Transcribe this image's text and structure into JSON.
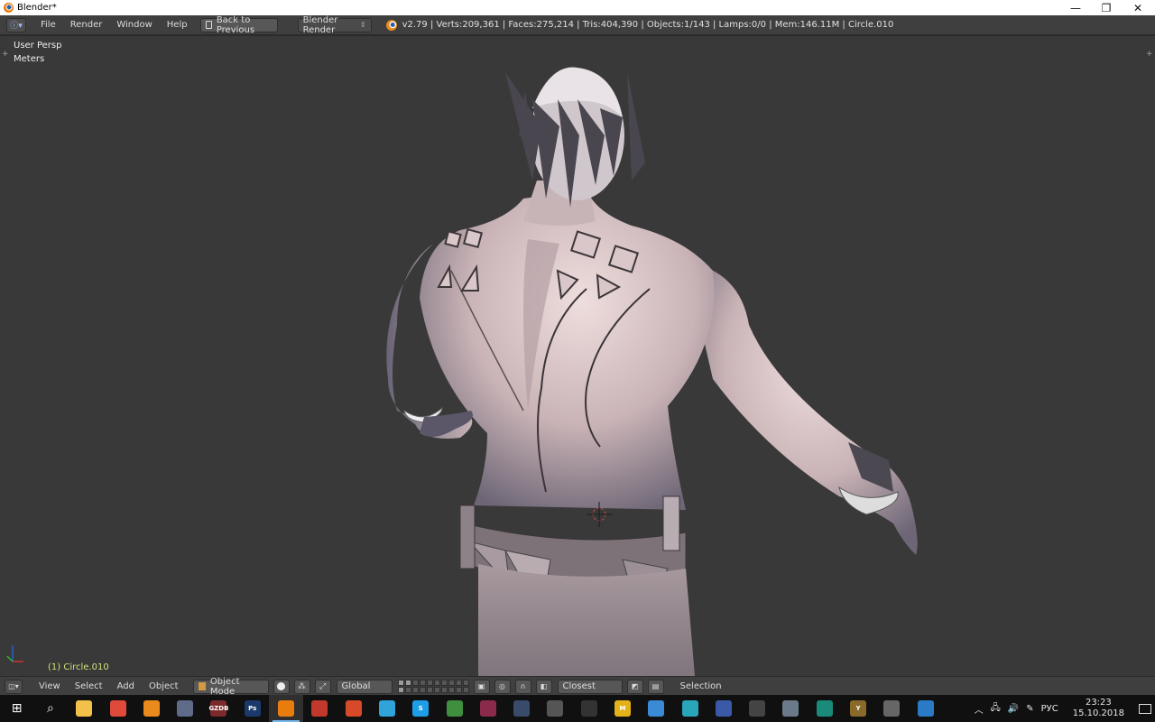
{
  "window": {
    "title": "Blender*",
    "controls": [
      "—",
      "❐",
      "✕"
    ]
  },
  "infobar": {
    "editor_icon": "info-icon",
    "menus": [
      "File",
      "Render",
      "Window",
      "Help"
    ],
    "back_button": "Back to Previous",
    "render_engine": "Blender Render",
    "stats": "v2.79 | Verts:209,361 | Faces:275,214 | Tris:404,390 | Objects:1/143 | Lamps:0/0 | Mem:146.11M | Circle.010"
  },
  "viewport": {
    "view_name": "User Persp",
    "units": "Meters",
    "active_object": "(1) Circle.010",
    "colors": {
      "background": "#393939",
      "object_label": "#cfe27a",
      "skin": "#d8c2c2"
    }
  },
  "header3d": {
    "menus": [
      "View",
      "Select",
      "Add",
      "Object"
    ],
    "mode": "Object Mode",
    "orientation": "Global",
    "snap_element": "Closest",
    "selection_label": "Selection"
  },
  "taskbar": {
    "apps": [
      {
        "name": "windows-start-icon",
        "glyph": "⊞",
        "color": "#101010"
      },
      {
        "name": "search-icon",
        "glyph": "⌕",
        "color": "#101010"
      },
      {
        "name": "file-explorer-icon",
        "glyph": "",
        "color": "#f2c14a"
      },
      {
        "name": "chrome-icon",
        "glyph": "",
        "color": "#e04a3a"
      },
      {
        "name": "app-orange-icon",
        "glyph": "",
        "color": "#e98a1c"
      },
      {
        "name": "app-shield-icon",
        "glyph": "",
        "color": "#5e6c8a"
      },
      {
        "name": "app-gzdb-icon",
        "glyph": "GZDB",
        "color": "#7a2a2a"
      },
      {
        "name": "photoshop-icon",
        "glyph": "Ps",
        "color": "#1b3a6b"
      },
      {
        "name": "blender-icon",
        "glyph": "",
        "color": "#e87d0d"
      },
      {
        "name": "steam-circle-icon",
        "glyph": "",
        "color": "#c0392b"
      },
      {
        "name": "app-red-icon",
        "glyph": "",
        "color": "#d64a2a"
      },
      {
        "name": "telegram-icon",
        "glyph": "",
        "color": "#2fa3da"
      },
      {
        "name": "skype-icon",
        "glyph": "S",
        "color": "#1f9ee8"
      },
      {
        "name": "app-green-icon",
        "glyph": "",
        "color": "#3f8f3f"
      },
      {
        "name": "substance-icon",
        "glyph": "",
        "color": "#8b2a4a"
      },
      {
        "name": "steam-icon",
        "glyph": "",
        "color": "#3a4a6a"
      },
      {
        "name": "app-wolf-icon",
        "glyph": "",
        "color": "#555555"
      },
      {
        "name": "unity-icon",
        "glyph": "",
        "color": "#333333"
      },
      {
        "name": "app-m-icon",
        "glyph": "M",
        "color": "#e3b21a"
      },
      {
        "name": "app-cloud-icon",
        "glyph": "",
        "color": "#3a8ad6"
      },
      {
        "name": "app-gear-icon",
        "glyph": "",
        "color": "#29a6b8"
      },
      {
        "name": "app-monitor-icon",
        "glyph": "",
        "color": "#3a5aa8"
      },
      {
        "name": "app-person-icon",
        "glyph": "",
        "color": "#444444"
      },
      {
        "name": "app-bird-icon",
        "glyph": "",
        "color": "#6a7a8a"
      },
      {
        "name": "app-teal-icon",
        "glyph": "",
        "color": "#1a8a7a"
      },
      {
        "name": "app-y-icon",
        "glyph": "Y",
        "color": "#8a6a2a"
      },
      {
        "name": "zbrush-icon",
        "glyph": "",
        "color": "#666666"
      },
      {
        "name": "image-viewer-icon",
        "glyph": "",
        "color": "#2a7ac6"
      }
    ],
    "tray": {
      "lang": "РУС",
      "time": "23:23",
      "date": "15.10.2018"
    }
  }
}
